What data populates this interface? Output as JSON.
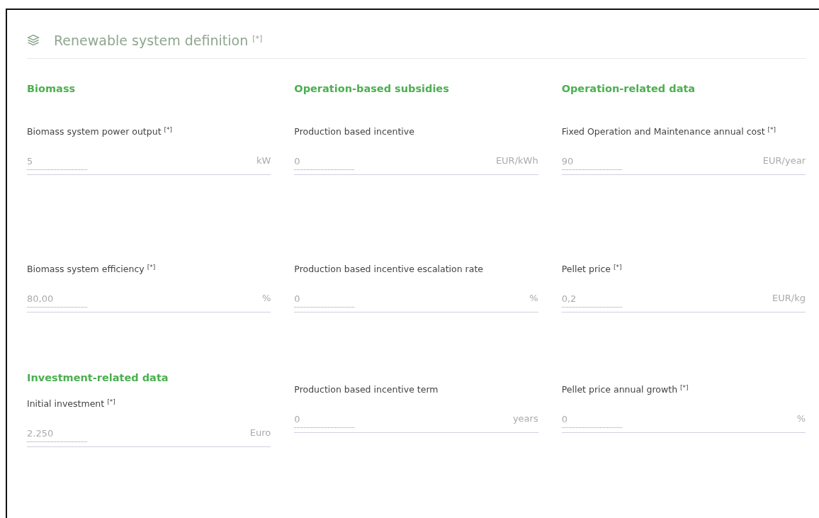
{
  "panel": {
    "title": "Renewable system definition $^{[*]}$"
  },
  "rows": [
    [
      {
        "heading": "Biomass"
      },
      {
        "heading": "Operation-based subsidies"
      },
      {
        "heading": "Operation-related data"
      }
    ],
    [
      {
        "field": {
          "label": "Biomass system power output $^{[*]}$",
          "value": "5",
          "unit": "kW"
        }
      },
      {
        "field": {
          "label": "Production based incentive",
          "value": "0",
          "unit": "EUR/kWh"
        }
      },
      {
        "field": {
          "label": "Fixed Operation and Maintenance annual cost $^{[*]}$",
          "value": "90",
          "unit": "EUR/year"
        }
      }
    ],
    [
      {
        "field": {
          "label": "Biomass system efficiency $^{[*]}$",
          "value": "80,00",
          "unit": "%"
        }
      },
      {
        "field": {
          "label": "Production based incentive escalation rate",
          "value": "0",
          "unit": "%"
        }
      },
      {
        "field": {
          "label": "Pellet price $^{[*]}$",
          "value": "0,2",
          "unit": "EUR/kg"
        }
      }
    ],
    [
      {
        "heading": "Investment-related data",
        "field": {
          "label": "Initial investment $^{[*]}$",
          "value": "2.250",
          "unit": "Euro"
        }
      },
      {
        "field": {
          "label": "Production based incentive term",
          "value": "0",
          "unit": "years"
        }
      },
      {
        "field": {
          "label": "Pellet price annual growth $^{[*]}$",
          "value": "0",
          "unit": "%"
        }
      }
    ]
  ]
}
